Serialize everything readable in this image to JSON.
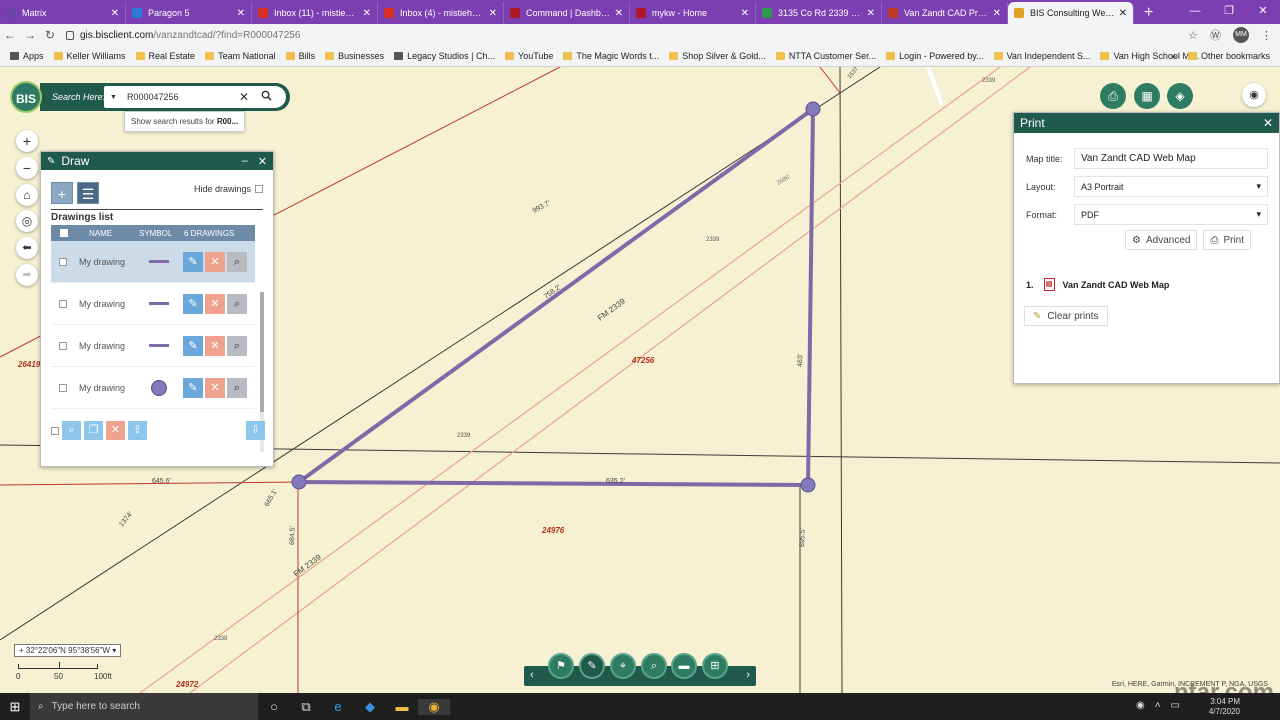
{
  "browser": {
    "tabs": [
      {
        "label": "Matrix",
        "color": "#6b46a8",
        "active": false
      },
      {
        "label": "Paragon 5",
        "color": "#2b7bd8",
        "active": false
      },
      {
        "label": "Inbox (11) - mistiehom",
        "color": "#d93025",
        "active": false
      },
      {
        "label": "Inbox (4) - mistiehome",
        "color": "#d93025",
        "active": false
      },
      {
        "label": "Command | Dashboard",
        "color": "#b0182a",
        "active": false
      },
      {
        "label": "mykw - Home",
        "color": "#b0182a",
        "active": false
      },
      {
        "label": "3135 Co Rd 2339 - Go",
        "color": "#2e9a50",
        "active": false
      },
      {
        "label": "Van Zandt CAD Proper",
        "color": "#c0392b",
        "active": false
      },
      {
        "label": "BIS Consulting Web Ap",
        "color": "#e0a020",
        "active": true
      }
    ],
    "new_tab": "+",
    "url_host": "gis.bisclient.com",
    "url_path": "/vanzandtcad/?find=R000047256",
    "profile": "MM",
    "bookmarks": [
      "Apps",
      "Keller Williams",
      "Real Estate",
      "Team National",
      "Bills",
      "Businesses",
      "Legacy Studios | Ch...",
      "YouTube",
      "The Magic Words t...",
      "Shop Silver & Gold...",
      "NTTA Customer Ser...",
      "Login - Powered by...",
      "Van Independent S...",
      "Van High School Mi..."
    ],
    "more_bookmarks": "»",
    "other_bookmarks": "Other bookmarks"
  },
  "search": {
    "logo": "BIS",
    "label": "Search Here:",
    "value": "R000047256",
    "suggestion_prefix": "Show search results for ",
    "suggestion_bold": "R00..."
  },
  "map_controls": {
    "zoom_in": "+",
    "zoom_out": "−",
    "home": "⌂",
    "locate": "◎",
    "back": "⬅",
    "forward": "➡"
  },
  "draw": {
    "title": "Draw",
    "hide_label": "Hide drawings",
    "list_title": "Drawings list",
    "columns": {
      "name": "NAME",
      "symbol": "SYMBOL",
      "count": "6 DRAWINGS"
    },
    "rows": [
      {
        "name": "My drawing",
        "symbol": "line",
        "selected": true
      },
      {
        "name": "My drawing",
        "symbol": "line",
        "selected": false
      },
      {
        "name": "My drawing",
        "symbol": "line",
        "selected": false
      },
      {
        "name": "My drawing",
        "symbol": "point",
        "selected": false
      },
      {
        "name": "My drawing",
        "symbol": "point",
        "selected": false
      }
    ]
  },
  "print": {
    "title": "Print",
    "map_title_label": "Map title:",
    "map_title_value": "Van Zandt CAD Web Map",
    "layout_label": "Layout:",
    "layout_value": "A3 Portrait",
    "format_label": "Format:",
    "format_value": "PDF",
    "advanced_label": "Advanced",
    "print_label": "Print",
    "result_index": "1.",
    "result_name": "Van Zandt CAD Web Map",
    "clear_label": "Clear prints"
  },
  "map_labels": {
    "parcel_main": "47256",
    "parcel_south": "24976",
    "parcel_west": "26419",
    "parcel_sw": "24972",
    "road": "FM 2339",
    "road_lower": "FM 2339",
    "shield_a": "2339",
    "shield_b": "2339",
    "shield_c": "2339",
    "shield_d": "2339",
    "dim_hyp": "758.2'",
    "dim_right": "463'",
    "dim_bottom": "635.2'",
    "dim_left1": "665.1'",
    "dim_left2": "684.5'",
    "dim_right2": "695.5'",
    "dim_top": "993.7'",
    "dim_645": "645.6'",
    "dim_1374": "1374'",
    "dim_2686": "2686'",
    "dim_1537": "1537'",
    "dim_2339": "2339'"
  },
  "status": {
    "coords": "32°22'06\"N 95°38'56\"W",
    "scale_0": "0",
    "scale_50": "50",
    "scale_100": "100ft",
    "attribution": "Esri, HERE, Garmin, INCREMENT P, NGA, USGS",
    "watermark": "ntar.com"
  },
  "taskbar": {
    "search_placeholder": "Type here to search",
    "time": "3:04 PM",
    "date": "4/7/2020"
  },
  "colors": {
    "panel_header": "#1f5a4a",
    "drawing": "#7d6aa6",
    "tab_bar": "#7b3fb2"
  }
}
